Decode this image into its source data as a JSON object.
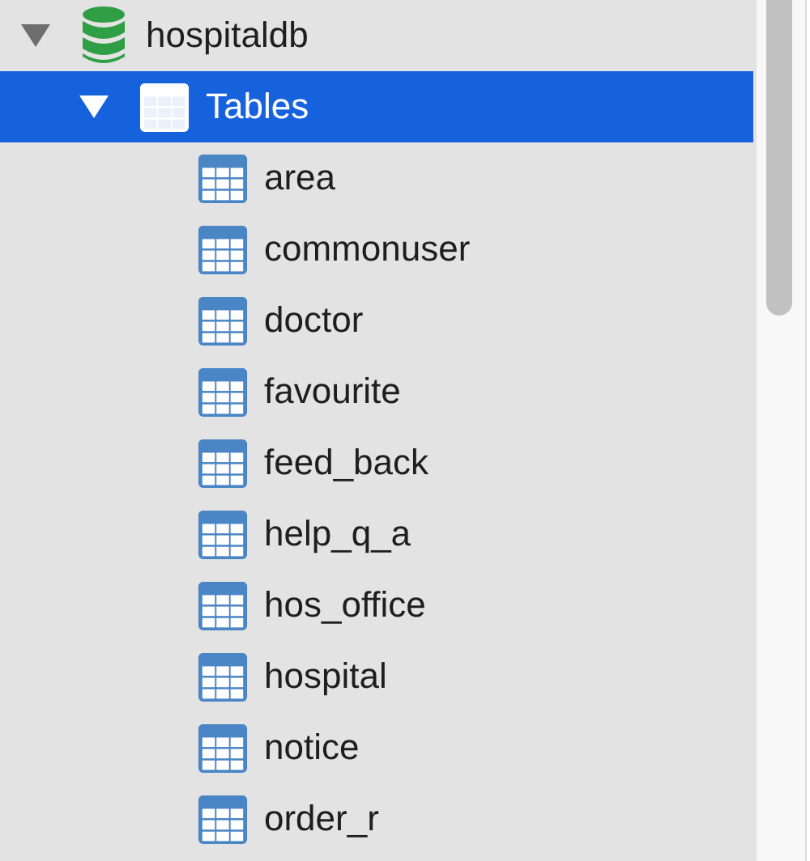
{
  "tree": [
    {
      "label": "hospitaldb",
      "kind": "database",
      "expanded": true,
      "selected": false,
      "children": [
        {
          "label": "Tables",
          "kind": "folder",
          "expanded": true,
          "selected": true,
          "children": [
            {
              "label": "area",
              "kind": "table",
              "selected": false
            },
            {
              "label": "commonuser",
              "kind": "table",
              "selected": false
            },
            {
              "label": "doctor",
              "kind": "table",
              "selected": false
            },
            {
              "label": "favourite",
              "kind": "table",
              "selected": false
            },
            {
              "label": "feed_back",
              "kind": "table",
              "selected": false
            },
            {
              "label": "help_q_a",
              "kind": "table",
              "selected": false
            },
            {
              "label": "hos_office",
              "kind": "table",
              "selected": false
            },
            {
              "label": "hospital",
              "kind": "table",
              "selected": false
            },
            {
              "label": "notice",
              "kind": "table",
              "selected": false
            },
            {
              "label": "order_r",
              "kind": "table",
              "selected": false
            }
          ]
        }
      ]
    }
  ]
}
